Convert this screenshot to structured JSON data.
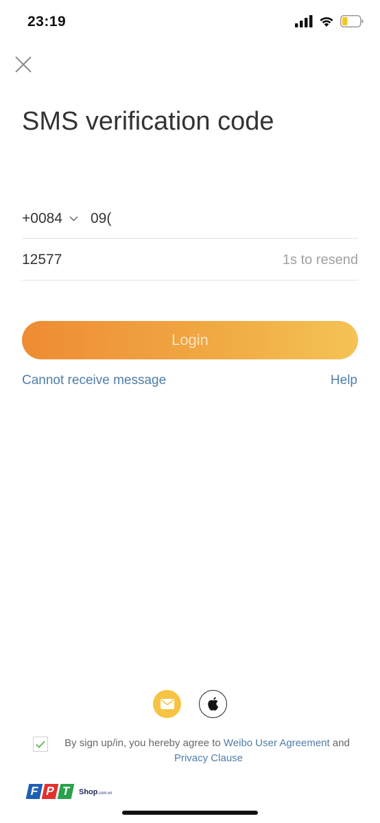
{
  "status_bar": {
    "time": "23:19",
    "icons": [
      "cellular-signal-icon",
      "wifi-icon",
      "battery-icon"
    ]
  },
  "header": {
    "close_icon": "close-icon",
    "title": "SMS verification code"
  },
  "form": {
    "country_code": "+0084",
    "phone_value": "09(",
    "code_value": "12577",
    "resend_text": "1s to resend"
  },
  "login_button": {
    "label": "Login"
  },
  "links": {
    "cannot_receive": "Cannot receive message",
    "help": "Help"
  },
  "social": {
    "icons": [
      "mail-icon",
      "apple-icon"
    ]
  },
  "agreement": {
    "checked": true,
    "prefix": "By sign up/in, you hereby agree to ",
    "user_agreement": "Weibo User Agreement",
    "conjunction": " and ",
    "privacy": "Privacy Clause"
  },
  "watermark": {
    "brand_letters": [
      "F",
      "P",
      "T"
    ],
    "shop": "Shop",
    "domain": ".com.vn"
  },
  "colors": {
    "accent_start": "#ee8c33",
    "accent_end": "#f4c355",
    "link": "#4f7da8",
    "mail_icon_bg": "#f6c442"
  }
}
